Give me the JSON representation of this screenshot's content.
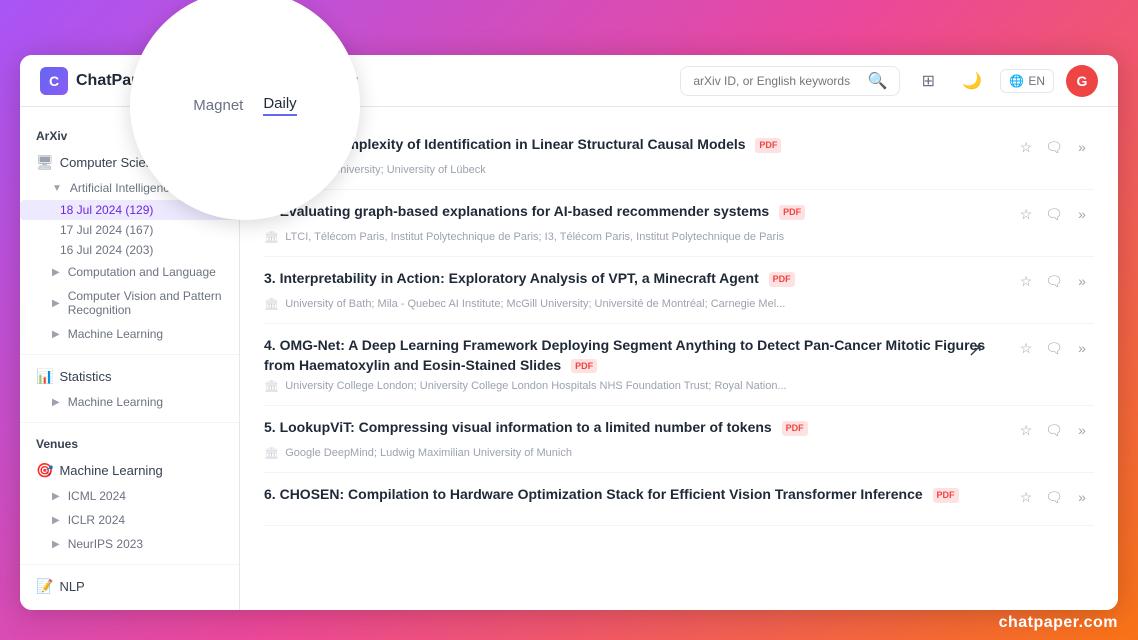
{
  "header": {
    "logo_text": "ChatPaper",
    "nav_items": [
      {
        "label": "Magnet",
        "active": false
      },
      {
        "label": "Daily",
        "active": true
      }
    ],
    "search_placeholder": "arXiv ID, or English keywords",
    "lang": "EN",
    "avatar_letter": "G"
  },
  "sidebar": {
    "arxiv_label": "ArXiv",
    "sections": [
      {
        "name": "Computer Science",
        "icon": "🖥",
        "children": [
          {
            "name": "Artificial Intelligence",
            "expanded": true,
            "dates": [
              {
                "label": "18 Jul 2024 (129)",
                "active": true
              },
              {
                "label": "17 Jul 2024 (167)",
                "active": false
              },
              {
                "label": "16 Jul 2024 (203)",
                "active": false
              }
            ]
          },
          {
            "name": "Computation and Language",
            "expanded": false
          },
          {
            "name": "Computer Vision and Pattern Recognition",
            "expanded": false
          },
          {
            "name": "Machine Learning",
            "expanded": false
          }
        ]
      },
      {
        "name": "Statistics",
        "icon": "📊",
        "children": [
          {
            "name": "Machine Learning",
            "expanded": false
          }
        ]
      }
    ],
    "venues_label": "Venues",
    "venues_section": {
      "name": "Machine Learning",
      "icon": "🎯",
      "items": [
        {
          "label": "ICML 2024"
        },
        {
          "label": "ICLR 2024"
        },
        {
          "label": "NeurIPS 2023"
        }
      ]
    },
    "nlp_label": "NLP",
    "nlp_icon": "📝"
  },
  "papers": [
    {
      "index": "1.",
      "title": "On the Complexity of Identification in Linear Structural Causal Models",
      "has_pdf": true,
      "authors": "Saarland University; University of Lübeck",
      "starred": false
    },
    {
      "index": "2.",
      "title": "Evaluating graph-based explanations for AI-based recommender systems",
      "has_pdf": true,
      "authors": "LTCI, Télécom Paris, Institut Polytechnique de Paris; I3, Télécom Paris, Institut Polytechnique de Paris",
      "starred": false
    },
    {
      "index": "3.",
      "title": "Interpretability in Action: Exploratory Analysis of VPT, a Minecraft Agent",
      "has_pdf": true,
      "authors": "University of Bath; Mila - Quebec AI Institute; McGill University; Université de Montréal; Carnegie Mel...",
      "starred": false
    },
    {
      "index": "4.",
      "title": "OMG-Net: A Deep Learning Framework Deploying Segment Anything to Detect Pan-Cancer Mitotic Figures from Haematoxylin and Eosin-Stained Slides",
      "has_pdf": true,
      "authors": "University College London; University College London Hospitals NHS Foundation Trust; Royal Nation...",
      "starred": false
    },
    {
      "index": "5.",
      "title": "LookupViT: Compressing visual information to a limited number of tokens",
      "has_pdf": true,
      "authors": "Google DeepMind; Ludwig Maximilian University of Munich",
      "starred": false
    },
    {
      "index": "6.",
      "title": "CHOSEN: Compilation to Hardware Optimization Stack for Efficient Vision Transformer Inference",
      "has_pdf": true,
      "authors": "",
      "starred": false
    }
  ],
  "tooltip": {
    "options": [
      {
        "label": "Magnet",
        "active": false
      },
      {
        "label": "Daily",
        "active": true
      }
    ]
  },
  "footer": {
    "brand": "chatpaper.com"
  }
}
